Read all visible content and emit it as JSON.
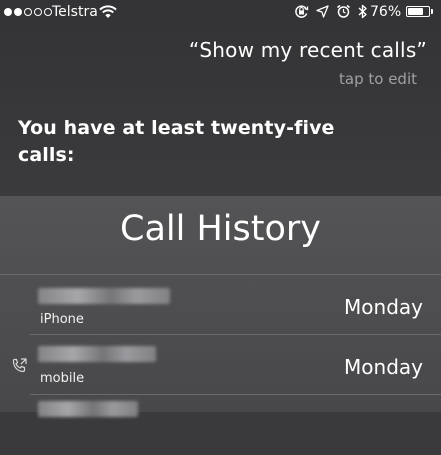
{
  "status_bar": {
    "carrier": "Telstra",
    "signal_bars_filled": 2,
    "signal_bars_total": 5,
    "battery_percent": "76%",
    "battery_level": 0.76,
    "icons": [
      "wifi-icon",
      "rotation-lock-icon",
      "location-arrow-icon",
      "alarm-icon",
      "bluetooth-icon",
      "battery-icon"
    ]
  },
  "siri": {
    "query": "“Show my recent calls”",
    "tap_to_edit": "tap to edit",
    "response_line1": "You have at least twenty-five",
    "response_line2": "calls:"
  },
  "call_history": {
    "title": "Call History",
    "items": [
      {
        "type": "iPhone",
        "date": "Monday",
        "outgoing": false
      },
      {
        "type": "mobile",
        "date": "Monday",
        "outgoing": true
      },
      {
        "type": "",
        "date": "",
        "outgoing": false
      }
    ]
  }
}
